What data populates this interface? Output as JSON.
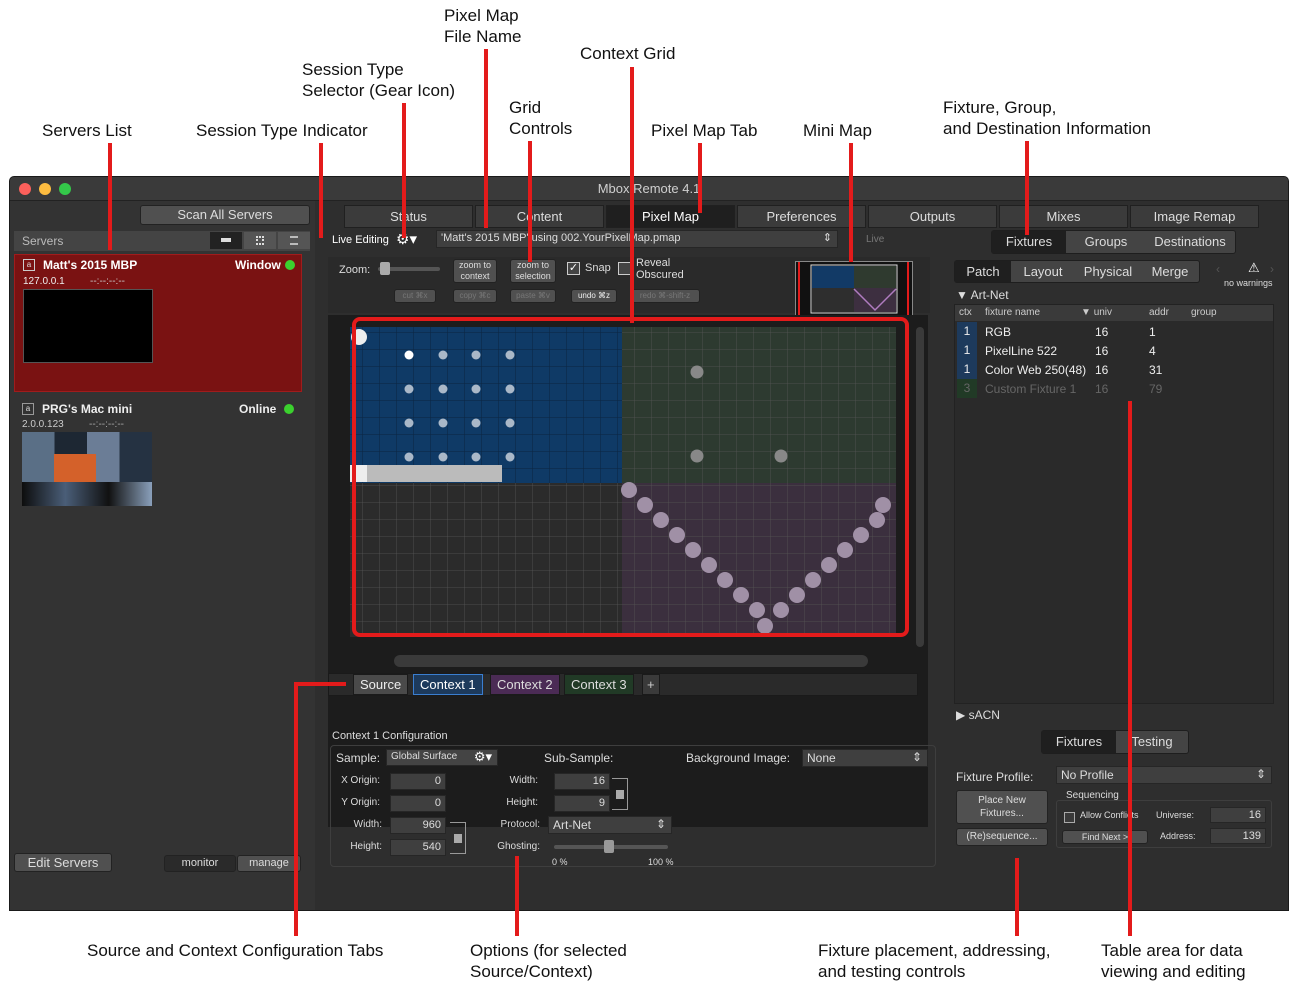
{
  "annotations": {
    "servers_list": "Servers List",
    "session_type_indicator": "Session Type Indicator",
    "session_type_selector": [
      "Session Type",
      "Selector (Gear Icon)"
    ],
    "pixel_map_file_name": [
      "Pixel Map",
      "File Name"
    ],
    "grid_controls": [
      "Grid",
      "Controls"
    ],
    "context_grid": "Context Grid",
    "pixel_map_tab": "Pixel Map Tab",
    "mini_map": "Mini Map",
    "fixture_info": [
      "Fixture, Group,",
      "and Destination Information"
    ],
    "source_context_tabs": "Source and Context Configuration Tabs",
    "options": [
      "Options (for selected",
      "Source/Context)"
    ],
    "fixture_controls": [
      "Fixture placement, addressing,",
      "and testing controls"
    ],
    "table_area": [
      "Table area for data",
      "viewing and editing"
    ]
  },
  "window": {
    "title": "Mbox Remote 4.1"
  },
  "sidebar": {
    "scan_button": "Scan All Servers",
    "header": "Servers",
    "servers": [
      {
        "name": "Matt's 2015 MBP",
        "ip": "127.0.0.1",
        "status": "Window",
        "extra": "--:--:--:--"
      },
      {
        "name": "PRG's Mac mini",
        "ip": "2.0.0.123",
        "status": "Online",
        "extra": "--:--:--:--"
      }
    ],
    "edit_button": "Edit Servers",
    "monitor": "monitor",
    "manage": "manage"
  },
  "tabs": [
    "Status",
    "Content",
    "Pixel Map",
    "Preferences",
    "Outputs",
    "Mixes",
    "Image Remap"
  ],
  "session": {
    "live_editing": "Live Editing",
    "file": "'Matt's 2015 MBP' using 002.YourPixelMap.pmap",
    "live": "Live"
  },
  "grid_controls": {
    "zoom": "Zoom:",
    "zoom_context": [
      "zoom to",
      "context"
    ],
    "zoom_selection": [
      "zoom to",
      "selection"
    ],
    "snap": "Snap",
    "reveal": [
      "Reveal",
      "Obscured"
    ],
    "cut": "cut ⌘x",
    "copy": "copy ⌘c",
    "paste": "paste ⌘v",
    "undo": "undo ⌘z",
    "redo": "redo ⌘-shift-z"
  },
  "context_tabs": [
    "Source",
    "Context 1",
    "Context 2",
    "Context 3",
    "+"
  ],
  "config": {
    "title": "Context 1 Configuration",
    "sample_label": "Sample:",
    "sample_value": "Global Surface",
    "x_origin_label": "X Origin:",
    "x_origin": "0",
    "y_origin_label": "Y Origin:",
    "y_origin": "0",
    "width_label": "Width:",
    "width": "960",
    "height_label": "Height:",
    "height": "540",
    "subsample": "Sub-Sample:",
    "sub_width": "16",
    "sub_height": "9",
    "protocol_label": "Protocol:",
    "protocol": "Art-Net",
    "ghosting_label": "Ghosting:",
    "ghost_min": "0 %",
    "ghost_max": "100 %",
    "bg_label": "Background Image:",
    "bg_value": "None"
  },
  "right": {
    "top_tabs": [
      "Fixtures",
      "Groups",
      "Destinations"
    ],
    "sub_tabs": [
      "Patch",
      "Layout",
      "Physical",
      "Merge"
    ],
    "warnings": "no warnings",
    "artnet": "Art-Net",
    "columns": [
      "ctx",
      "fixture name",
      "univ",
      "addr",
      "group"
    ],
    "rows": [
      {
        "ctx": "1",
        "name": "RGB",
        "univ": "16",
        "addr": "1"
      },
      {
        "ctx": "1",
        "name": "PixelLine 522",
        "univ": "16",
        "addr": "4"
      },
      {
        "ctx": "1",
        "name": "Color Web 250(48)",
        "univ": "16",
        "addr": "31"
      },
      {
        "ctx": "3",
        "name": "Custom Fixture 1",
        "univ": "16",
        "addr": "79"
      }
    ],
    "sacn": "sACN",
    "bottom_tabs": [
      "Fixtures",
      "Testing"
    ],
    "profile_label": "Fixture Profile:",
    "profile": "No Profile",
    "place": [
      "Place New",
      "Fixtures..."
    ],
    "resequence": "(Re)sequence...",
    "sequencing": "Sequencing",
    "allow": "Allow Conflicts",
    "universe_label": "Universe:",
    "universe": "16",
    "find_next": "Find Next >",
    "address_label": "Address:",
    "address": "139"
  }
}
